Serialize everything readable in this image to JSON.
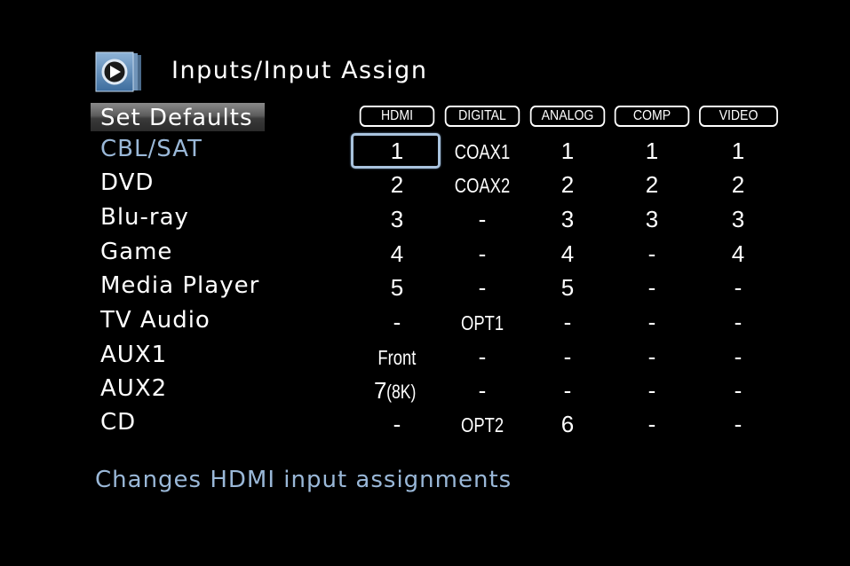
{
  "header": {
    "title": "Inputs/Input Assign",
    "icon": "arrow-right-icon"
  },
  "set_defaults_label": "Set Defaults",
  "columns": [
    "HDMI",
    "DIGITAL",
    "ANALOG",
    "COMP",
    "VIDEO"
  ],
  "rows": [
    {
      "label": "CBL/SAT",
      "cells": [
        "1",
        "COAX1",
        "1",
        "1",
        "1"
      ]
    },
    {
      "label": "DVD",
      "cells": [
        "2",
        "COAX2",
        "2",
        "2",
        "2"
      ]
    },
    {
      "label": "Blu-ray",
      "cells": [
        "3",
        "-",
        "3",
        "3",
        "3"
      ]
    },
    {
      "label": "Game",
      "cells": [
        "4",
        "-",
        "4",
        "-",
        "4"
      ]
    },
    {
      "label": "Media Player",
      "cells": [
        "5",
        "-",
        "5",
        "-",
        "-"
      ]
    },
    {
      "label": "TV Audio",
      "cells": [
        "-",
        "OPT1",
        "-",
        "-",
        "-"
      ]
    },
    {
      "label": "AUX1",
      "cells": [
        "Front",
        "-",
        "-",
        "-",
        "-"
      ]
    },
    {
      "label": "AUX2",
      "cells": [
        "7",
        "-",
        "-",
        "-",
        "-"
      ],
      "hdmi_suffix": "(8K)"
    },
    {
      "label": "CD",
      "cells": [
        "-",
        "OPT2",
        "6",
        "-",
        "-"
      ]
    }
  ],
  "footer_hint": "Changes HDMI input assignments",
  "colors": {
    "background": "#000000",
    "text": "#ffffff",
    "selected_text": "#9ab8d8",
    "focus_border": "#a9c3de"
  }
}
